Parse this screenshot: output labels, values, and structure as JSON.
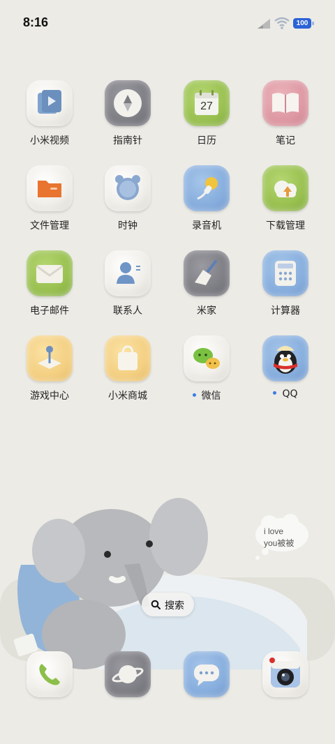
{
  "status_bar": {
    "time": "8:16",
    "battery": "100",
    "icons": [
      "cellular-signal-icon",
      "wifi-icon",
      "battery-icon"
    ]
  },
  "apps": [
    {
      "label": "小米视频",
      "icon": "video-icon"
    },
    {
      "label": "指南针",
      "icon": "compass-icon"
    },
    {
      "label": "日历",
      "icon": "calendar-icon",
      "date": "27"
    },
    {
      "label": "笔记",
      "icon": "notes-book-icon"
    },
    {
      "label": "文件管理",
      "icon": "folder-icon"
    },
    {
      "label": "时钟",
      "icon": "alarm-clock-icon"
    },
    {
      "label": "录音机",
      "icon": "microphone-icon"
    },
    {
      "label": "下载管理",
      "icon": "download-cloud-icon"
    },
    {
      "label": "电子邮件",
      "icon": "envelope-icon"
    },
    {
      "label": "联系人",
      "icon": "contact-person-icon"
    },
    {
      "label": "米家",
      "icon": "broom-icon"
    },
    {
      "label": "计算器",
      "icon": "calculator-icon"
    },
    {
      "label": "游戏中心",
      "icon": "joystick-icon"
    },
    {
      "label": "小米商城",
      "icon": "shopping-bag-icon"
    },
    {
      "label": "微信",
      "icon": "wechat-icon",
      "new_dot": true
    },
    {
      "label": "QQ",
      "icon": "qq-penguin-icon",
      "new_dot": true
    }
  ],
  "wallpaper": {
    "thought_line1": "i love",
    "thought_line2": "you被被"
  },
  "search": {
    "label": "搜索"
  },
  "dock": [
    {
      "icon": "phone-icon"
    },
    {
      "icon": "browser-planet-icon"
    },
    {
      "icon": "messages-icon"
    },
    {
      "icon": "camera-icon"
    }
  ],
  "colors": {
    "background": "#ecebe6",
    "accent_dot": "#3a7de0",
    "battery": "#2b62d6"
  }
}
